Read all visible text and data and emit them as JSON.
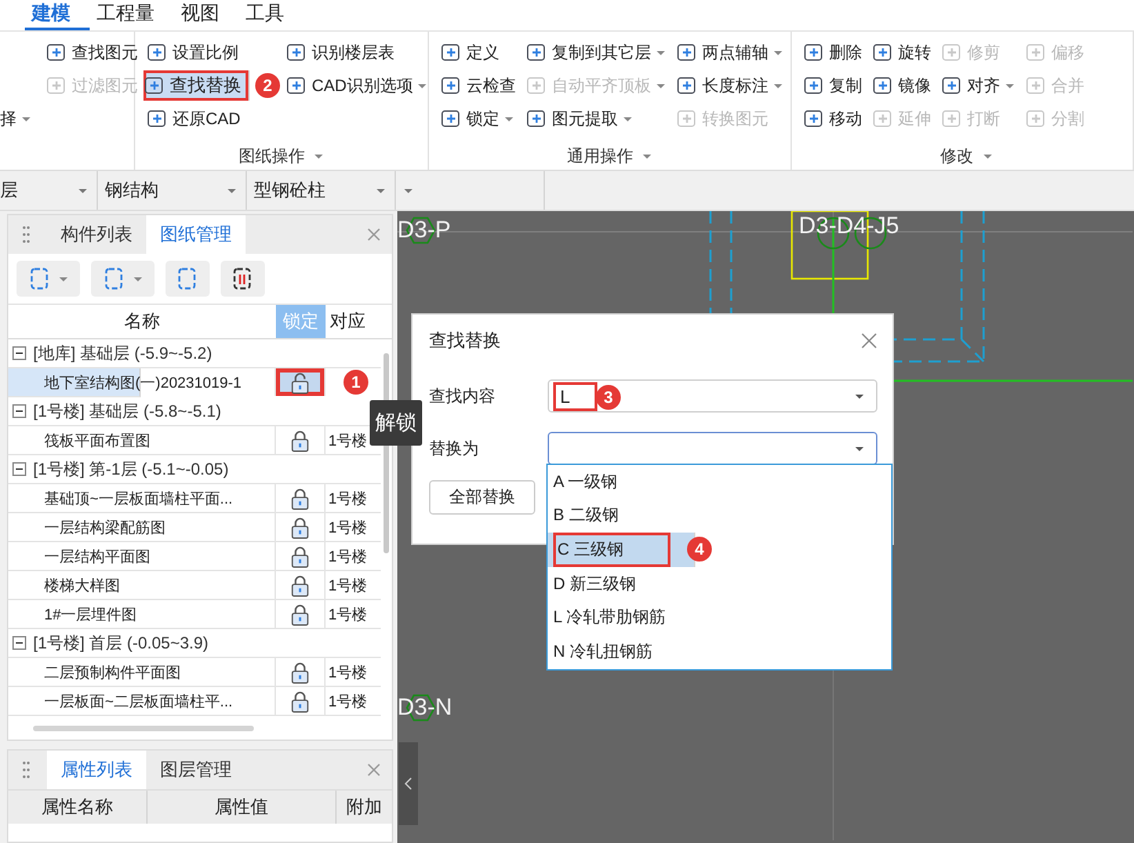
{
  "menu_tabs": [
    {
      "label": "建模",
      "selected": true
    },
    {
      "label": "工程量",
      "selected": false
    },
    {
      "label": "视图",
      "selected": false
    },
    {
      "label": "工具",
      "selected": false
    }
  ],
  "ribbon": {
    "groups": [
      {
        "columns": [
          [
            {
              "label": "择",
              "kind": "cut",
              "dropdown": true,
              "disabled": false,
              "selected": false
            }
          ],
          [
            {
              "label": "查找图元",
              "disabled": false,
              "dropdown": false,
              "selected": false
            },
            {
              "label": "过滤图元",
              "disabled": true,
              "dropdown": false,
              "selected": false
            }
          ]
        ]
      },
      {
        "label": "图纸操作",
        "columns": [
          [
            {
              "label": "设置比例",
              "disabled": false,
              "dropdown": false,
              "selected": false
            },
            {
              "label": "查找替换",
              "disabled": false,
              "dropdown": false,
              "selected": true,
              "callout": "2"
            },
            {
              "label": "还原CAD",
              "disabled": false,
              "dropdown": false,
              "selected": false
            }
          ],
          [
            {
              "label": "识别楼层表",
              "disabled": false,
              "dropdown": false,
              "selected": false
            },
            {
              "label": "CAD识别选项",
              "disabled": false,
              "dropdown": true,
              "selected": false
            }
          ]
        ]
      },
      {
        "label": "通用操作",
        "columns": [
          [
            {
              "label": "定义",
              "disabled": false,
              "dropdown": false,
              "selected": false
            },
            {
              "label": "云检查",
              "disabled": false,
              "dropdown": false,
              "selected": false
            },
            {
              "label": "锁定",
              "disabled": false,
              "dropdown": true,
              "selected": false
            }
          ],
          [
            {
              "label": "复制到其它层",
              "disabled": false,
              "dropdown": true,
              "selected": false
            },
            {
              "label": "自动平齐顶板",
              "disabled": true,
              "dropdown": true,
              "selected": false
            },
            {
              "label": "图元提取",
              "disabled": false,
              "dropdown": true,
              "selected": false
            }
          ],
          [
            {
              "label": "两点辅轴",
              "disabled": false,
              "dropdown": true,
              "selected": false
            },
            {
              "label": "长度标注",
              "disabled": false,
              "dropdown": true,
              "selected": false
            },
            {
              "label": "转换图元",
              "disabled": true,
              "dropdown": false,
              "selected": false
            }
          ]
        ]
      },
      {
        "label": "修改",
        "columns": [
          [
            {
              "label": "删除",
              "disabled": false,
              "dropdown": false,
              "selected": false
            },
            {
              "label": "复制",
              "disabled": false,
              "dropdown": false,
              "selected": false
            },
            {
              "label": "移动",
              "disabled": false,
              "dropdown": false,
              "selected": false
            }
          ],
          [
            {
              "label": "旋转",
              "disabled": false,
              "dropdown": false,
              "selected": false
            },
            {
              "label": "镜像",
              "disabled": false,
              "dropdown": false,
              "selected": false
            },
            {
              "label": "延伸",
              "disabled": true,
              "dropdown": false,
              "selected": false
            }
          ],
          [
            {
              "label": "修剪",
              "disabled": true,
              "dropdown": false,
              "selected": false
            },
            {
              "label": "对齐",
              "disabled": false,
              "dropdown": true,
              "selected": false
            },
            {
              "label": "打断",
              "disabled": true,
              "dropdown": false,
              "selected": false
            }
          ],
          [
            {
              "label": "偏移",
              "disabled": true,
              "dropdown": false,
              "selected": false
            },
            {
              "label": "合并",
              "disabled": true,
              "dropdown": false,
              "selected": false
            },
            {
              "label": "分割",
              "disabled": true,
              "dropdown": false,
              "selected": false
            }
          ]
        ]
      }
    ]
  },
  "selectors": [
    {
      "value": "层"
    },
    {
      "value": "钢结构"
    },
    {
      "value": "型钢砼柱"
    },
    {
      "kind": "empty"
    }
  ],
  "drawing_panel": {
    "tabs": [
      {
        "label": "构件列表",
        "selected": false
      },
      {
        "label": "图纸管理",
        "selected": true
      }
    ],
    "columns": [
      {
        "label": "名称",
        "selected": false
      },
      {
        "label": "锁定",
        "selected": true
      },
      {
        "label": "对应",
        "selected": false
      }
    ],
    "groups": [
      {
        "label": "[地库] 基础层 (-5.9~-5.2)",
        "expanded": true,
        "children": [
          {
            "name": "地下室结构图(一)20231019-1",
            "locked": false,
            "selected": true,
            "callout": "1"
          }
        ]
      },
      {
        "label": "[1号楼] 基础层 (-5.8~-5.1)",
        "expanded": true,
        "children": [
          {
            "name": "筏板平面布置图",
            "locked": true,
            "selected": false,
            "floor": "1号楼"
          }
        ]
      },
      {
        "label": "[1号楼] 第-1层 (-5.1~-0.05)",
        "expanded": true,
        "children": [
          {
            "name": "基础顶~一层板面墙柱平面...",
            "locked": true,
            "selected": false,
            "floor": "1号楼"
          },
          {
            "name": "一层结构梁配筋图",
            "locked": true,
            "selected": false,
            "floor": "1号楼"
          },
          {
            "name": "一层结构平面图",
            "locked": true,
            "selected": false,
            "floor": "1号楼"
          },
          {
            "name": "楼梯大样图",
            "locked": true,
            "selected": false,
            "floor": "1号楼"
          },
          {
            "name": "1#一层埋件图",
            "locked": true,
            "selected": false,
            "floor": "1号楼"
          }
        ]
      },
      {
        "label": "[1号楼] 首层 (-0.05~3.9)",
        "expanded": true,
        "children": [
          {
            "name": "二层预制构件平面图",
            "locked": true,
            "selected": false,
            "floor": "1号楼"
          },
          {
            "name": "一层板面~二层板面墙柱平...",
            "locked": true,
            "selected": false,
            "floor": "1号楼"
          }
        ]
      }
    ]
  },
  "tooltip": "解锁",
  "property_panel": {
    "tabs": [
      {
        "label": "属性列表",
        "selected": true
      },
      {
        "label": "图层管理",
        "selected": false
      }
    ],
    "columns": [
      "属性名称",
      "属性值",
      "附加"
    ]
  },
  "canvas": {
    "labels": [
      "D3-P",
      "D3-D4-J5",
      "D3-N"
    ]
  },
  "dialog": {
    "title": "查找替换",
    "fields": [
      {
        "label": "查找内容",
        "value": "L",
        "focused": false,
        "callout": "3"
      },
      {
        "label": "替换为",
        "focused": true
      }
    ],
    "button": "全部替换",
    "options": [
      {
        "label": "A 一级钢",
        "selected": false
      },
      {
        "label": "B 二级钢",
        "selected": false
      },
      {
        "label": "C 三级钢",
        "selected": true,
        "callout": "4"
      },
      {
        "label": "D 新三级钢",
        "selected": false
      },
      {
        "label": "L 冷轧带肋钢筋",
        "selected": false
      },
      {
        "label": "N 冷轧扭钢筋",
        "selected": false
      }
    ]
  }
}
